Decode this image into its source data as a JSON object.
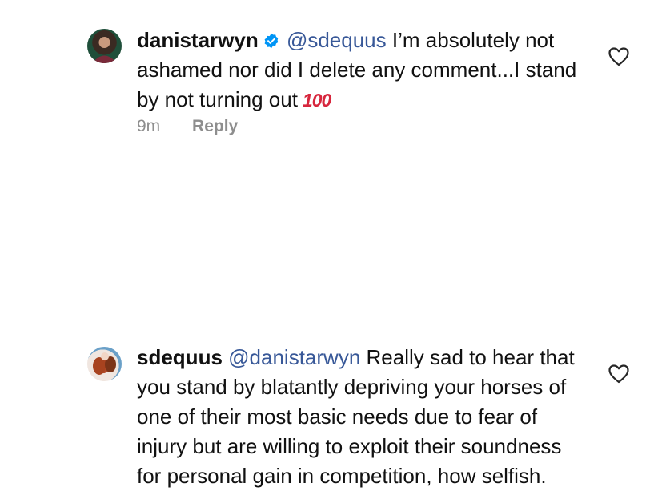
{
  "comments": [
    {
      "username": "danistarwyn",
      "verified": true,
      "mention": "@sdequus",
      "text": "I’m absolutely not ashamed nor did I delete any comment...I stand by not turning out",
      "emoji": "100",
      "time": "9m",
      "reply_label": "Reply"
    },
    {
      "username": "sdequus",
      "verified": false,
      "mention": "@danistarwyn",
      "text": "Really sad to hear that you stand by blatantly depriving your horses of one of their most basic needs due to fear of injury but are willing to exploit their soundness for personal gain in competition, how selfish."
    }
  ],
  "colors": {
    "mention": "#385898",
    "meta": "#8e8e8e",
    "verified": "#0095f6",
    "emoji": "#d7263d"
  },
  "icons": [
    "verified-badge-icon",
    "heart-icon",
    "hundred-points-emoji"
  ]
}
